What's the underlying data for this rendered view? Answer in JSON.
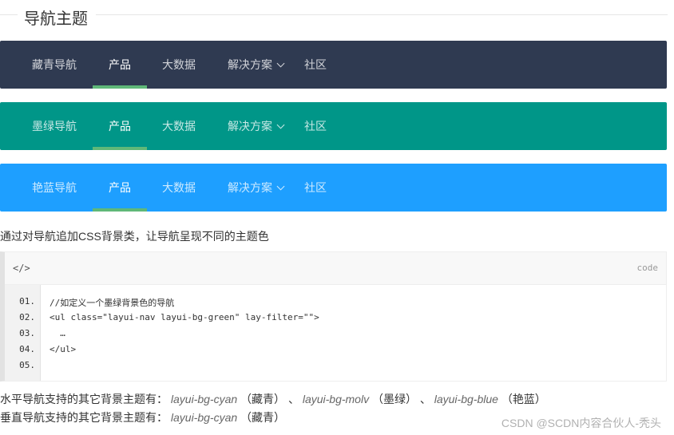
{
  "section": {
    "title": "导航主题"
  },
  "navs": [
    {
      "name": "藏青导航",
      "color": "#2f3a51",
      "items": [
        "产品",
        "大数据",
        "解决方案",
        "社区"
      ]
    },
    {
      "name": "墨绿导航",
      "color": "#009688",
      "items": [
        "产品",
        "大数据",
        "解决方案",
        "社区"
      ]
    },
    {
      "name": "艳蓝导航",
      "color": "#1E9FFF",
      "items": [
        "产品",
        "大数据",
        "解决方案",
        "社区"
      ]
    }
  ],
  "active_bar_color": "#5FB878",
  "description": "通过对导航追加CSS背景类，让导航呈现不同的主题色",
  "code": {
    "tag": "</>",
    "label": "code",
    "line_numbers": [
      "01.",
      "02.",
      "03.",
      "04.",
      "05."
    ],
    "lines": [
      "//如定义一个墨绿背景色的导航",
      "<ul class=\"layui-nav layui-bg-green\" lay-filter=\"\">",
      "  …",
      "</ul>",
      ""
    ]
  },
  "support": {
    "horizontal_prefix": "水平导航支持的其它背景主题有：",
    "horizontal": [
      {
        "cls": "layui-bg-cyan",
        "note": "（藏青）"
      },
      {
        "cls": "layui-bg-molv",
        "note": "（墨绿）"
      },
      {
        "cls": "layui-bg-blue",
        "note": "（艳蓝）"
      }
    ],
    "separator": "、",
    "vertical_prefix": "垂直导航支持的其它背景主题有：",
    "vertical": [
      {
        "cls": "layui-bg-cyan",
        "note": "（藏青）"
      }
    ]
  },
  "watermark": "CSDN @SCDN内容合伙人-秃头"
}
